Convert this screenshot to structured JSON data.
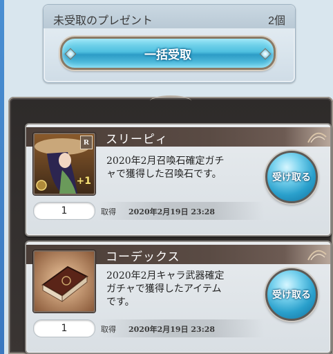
{
  "header": {
    "title": "未受取のプレゼント",
    "count": "2個",
    "bulk_receive_label": "一括受取"
  },
  "items": [
    {
      "name": "スリーピィ",
      "description_lines": [
        "2020年2月召喚石確定ガチ",
        "ャで獲得した召喚石です。"
      ],
      "quantity": "1",
      "acquired_label": "取得",
      "acquired_date": "2020年2月19日 23:28",
      "receive_label": "受け取る",
      "badge_rank": "R",
      "badge_plus": "+1",
      "thumbnail_icon": "summon-sleepy-icon"
    },
    {
      "name": "コーデックス",
      "description_lines": [
        "2020年2月キャラ武器確定",
        "ガチャで獲得したアイテム",
        "です。"
      ],
      "quantity": "1",
      "acquired_label": "取得",
      "acquired_date": "2020年2月19日 23:28",
      "receive_label": "受け取る",
      "thumbnail_icon": "codex-book-icon"
    }
  ],
  "colors": {
    "accent_blue": "#2aa0cc",
    "panel_dark": "#2e2b2a",
    "name_bar": "#4a3d37"
  }
}
